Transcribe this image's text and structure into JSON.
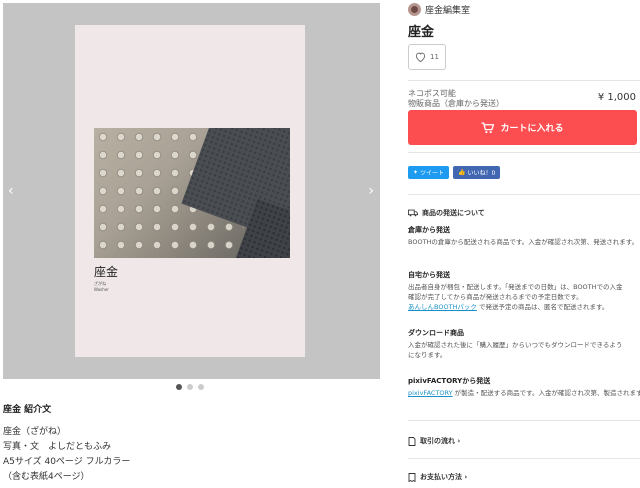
{
  "gallery": {
    "book_title": "座金",
    "book_sub1": "ざがね",
    "book_sub2": "Washer",
    "prev_arrow": "‹",
    "next_arrow": "›"
  },
  "description": {
    "heading": "座金 紹介文",
    "lines": [
      "座金（ざがね）",
      "写真・文　よしだともふみ",
      "A5サイズ 40ページ フルカラー",
      "（含む表紙4ページ）"
    ]
  },
  "shop": {
    "name": "座金編集室"
  },
  "item": {
    "title": "座金",
    "like_count": "11",
    "shipping_type_1": "ネコポス可能",
    "shipping_type_2": "物販商品（倉庫から発送）",
    "price": "¥ 1,000",
    "cart_label": "カートに入れる"
  },
  "social": {
    "tweet": "ツイート",
    "like": "いいね！0"
  },
  "shipping": {
    "title": "商品の発送について",
    "warehouse_heading": "倉庫から発送",
    "warehouse_text": "BOOTHの倉庫から配送される商品です。入金が確認され次第、発送されます。",
    "self_heading": "自宅から発送",
    "self_text_1": "出品者自身が梱包・配送します。「発送までの日数」は、BOOTHでの入金",
    "self_text_2": "確認が完了してから商品が発送されるまでの予定日数です。",
    "self_link": "あんしんBOOTHパック",
    "self_text_3": " で発送予定の商品は、匿名で配送されます。",
    "download_heading": "ダウンロード商品",
    "download_text_1": "入金が確認された後に「購入履歴」からいつでもダウンロードできるよう",
    "download_text_2": "になります。",
    "factory_heading": "pixivFACTORYから発送",
    "factory_link": "pixivFACTORY",
    "factory_text": " が製造・配送する商品です。入金が確認され次第、製造されます。"
  },
  "links": {
    "transaction_flow": "取引の流れ ›",
    "payment": "お支払い方法 ›"
  },
  "colors": {
    "cart": "#fc4d50",
    "twitter": "#1d9bf0",
    "facebook": "#4267b2",
    "link": "#1a90c8"
  }
}
